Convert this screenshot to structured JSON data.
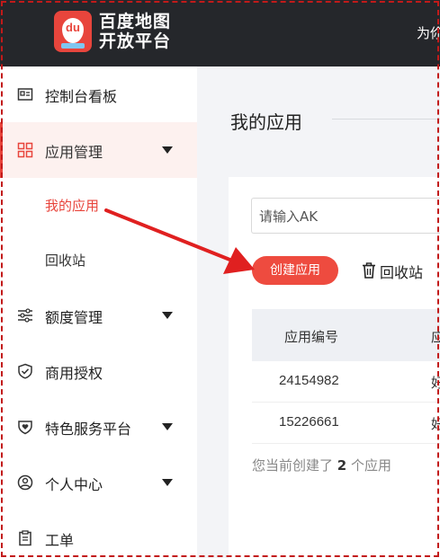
{
  "header": {
    "logo_line1": "百度地图",
    "logo_line2": "开放平台",
    "logo_badge": "du",
    "right_link": "为伱"
  },
  "sidebar": {
    "items": [
      {
        "label": "控制台看板",
        "icon": "dashboard-icon"
      },
      {
        "label": "应用管理",
        "icon": "grid-icon",
        "active": true,
        "expanded": true
      },
      {
        "label": "额度管理",
        "icon": "sliders-icon"
      },
      {
        "label": "商用授权",
        "icon": "shield-check-icon"
      },
      {
        "label": "特色服务平台",
        "icon": "heart-shield-icon"
      },
      {
        "label": "个人中心",
        "icon": "user-circle-icon"
      },
      {
        "label": "工单",
        "icon": "clipboard-icon"
      }
    ],
    "sub_items": [
      {
        "label": "我的应用",
        "active": true
      },
      {
        "label": "回收站"
      }
    ]
  },
  "main": {
    "title": "我的应用",
    "search_placeholder": "请输入AK",
    "create_button": "创建应用",
    "recycle_button": "回收站",
    "table": {
      "headers": [
        "应用编号",
        "应"
      ],
      "rows": [
        {
          "id": "24154982",
          "next": "好"
        },
        {
          "id": "15226661",
          "next": "好"
        }
      ]
    },
    "summary_prefix": "您当前创建了",
    "summary_count": "2",
    "summary_suffix": "个应用"
  },
  "colors": {
    "brand_red": "#e8453c",
    "header_bg": "#25272b",
    "annotation_red": "#c21a1a"
  }
}
